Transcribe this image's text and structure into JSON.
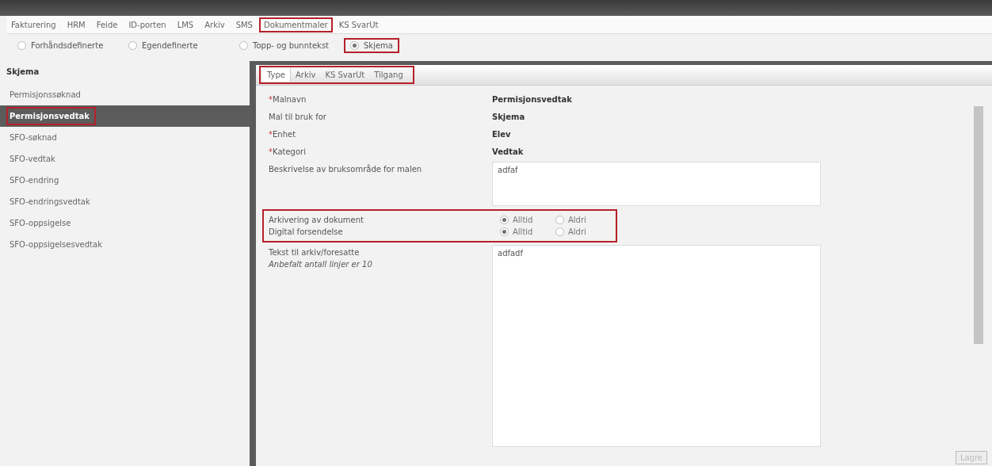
{
  "menu": [
    {
      "label": "Fakturering",
      "selected": false
    },
    {
      "label": "HRM",
      "selected": false
    },
    {
      "label": "Feide",
      "selected": false
    },
    {
      "label": "ID-porten",
      "selected": false
    },
    {
      "label": "LMS",
      "selected": false
    },
    {
      "label": "Arkiv",
      "selected": false
    },
    {
      "label": "SMS",
      "selected": false
    },
    {
      "label": "Dokumentmaler",
      "selected": true
    },
    {
      "label": "KS SvarUt",
      "selected": false
    }
  ],
  "template_types": [
    {
      "label": "Forhåndsdefinerte",
      "selected": false
    },
    {
      "label": "Egendefinerte",
      "selected": false
    },
    {
      "label": "Topp- og bunntekst",
      "selected": false
    },
    {
      "label": "Skjema",
      "selected": true
    }
  ],
  "sidebar": {
    "title": "Skjema",
    "items": [
      {
        "label": "Permisjonssøknad",
        "selected": false
      },
      {
        "label": "Permisjonsvedtak",
        "selected": true
      },
      {
        "label": "SFO-søknad",
        "selected": false
      },
      {
        "label": "SFO-vedtak",
        "selected": false
      },
      {
        "label": "SFO-endring",
        "selected": false
      },
      {
        "label": "SFO-endringsvedtak",
        "selected": false
      },
      {
        "label": "SFO-oppsigelse",
        "selected": false
      },
      {
        "label": "SFO-oppsigelsesvedtak",
        "selected": false
      }
    ]
  },
  "tabs": [
    {
      "label": "Type",
      "selected": true
    },
    {
      "label": "Arkiv",
      "selected": false
    },
    {
      "label": "KS SvarUt",
      "selected": false
    },
    {
      "label": "Tilgang",
      "selected": false
    }
  ],
  "fields": [
    {
      "kind": "text",
      "marker": "*",
      "label": "Malnavn",
      "value": "Permisjonsvedtak"
    },
    {
      "kind": "text",
      "label": "Mal til bruk for",
      "value": "Skjema"
    },
    {
      "kind": "text",
      "marker": "*",
      "label": "Enhet",
      "value": "Elev"
    },
    {
      "kind": "text",
      "marker": "*",
      "label": "Kategori",
      "value": "Vedtak"
    },
    {
      "kind": "textarea",
      "label": "Beskrivelse av bruksområde for malen",
      "value": "adfaf"
    }
  ],
  "options": [
    {
      "label": "Arkivering av dokument",
      "choices": [
        {
          "label": "Alltid",
          "selected": true
        },
        {
          "label": "Aldri",
          "selected": false
        }
      ]
    },
    {
      "label": "Digital forsendelse",
      "choices": [
        {
          "label": "Alltid",
          "selected": true
        },
        {
          "label": "Aldri",
          "selected": false
        }
      ]
    }
  ],
  "text_field": {
    "label": "Tekst til arkiv/foresatte",
    "hint": "Anbefalt antall linjer er 10",
    "value": "adfadf"
  },
  "save_button": {
    "label": "Lagre",
    "disabled": true
  }
}
